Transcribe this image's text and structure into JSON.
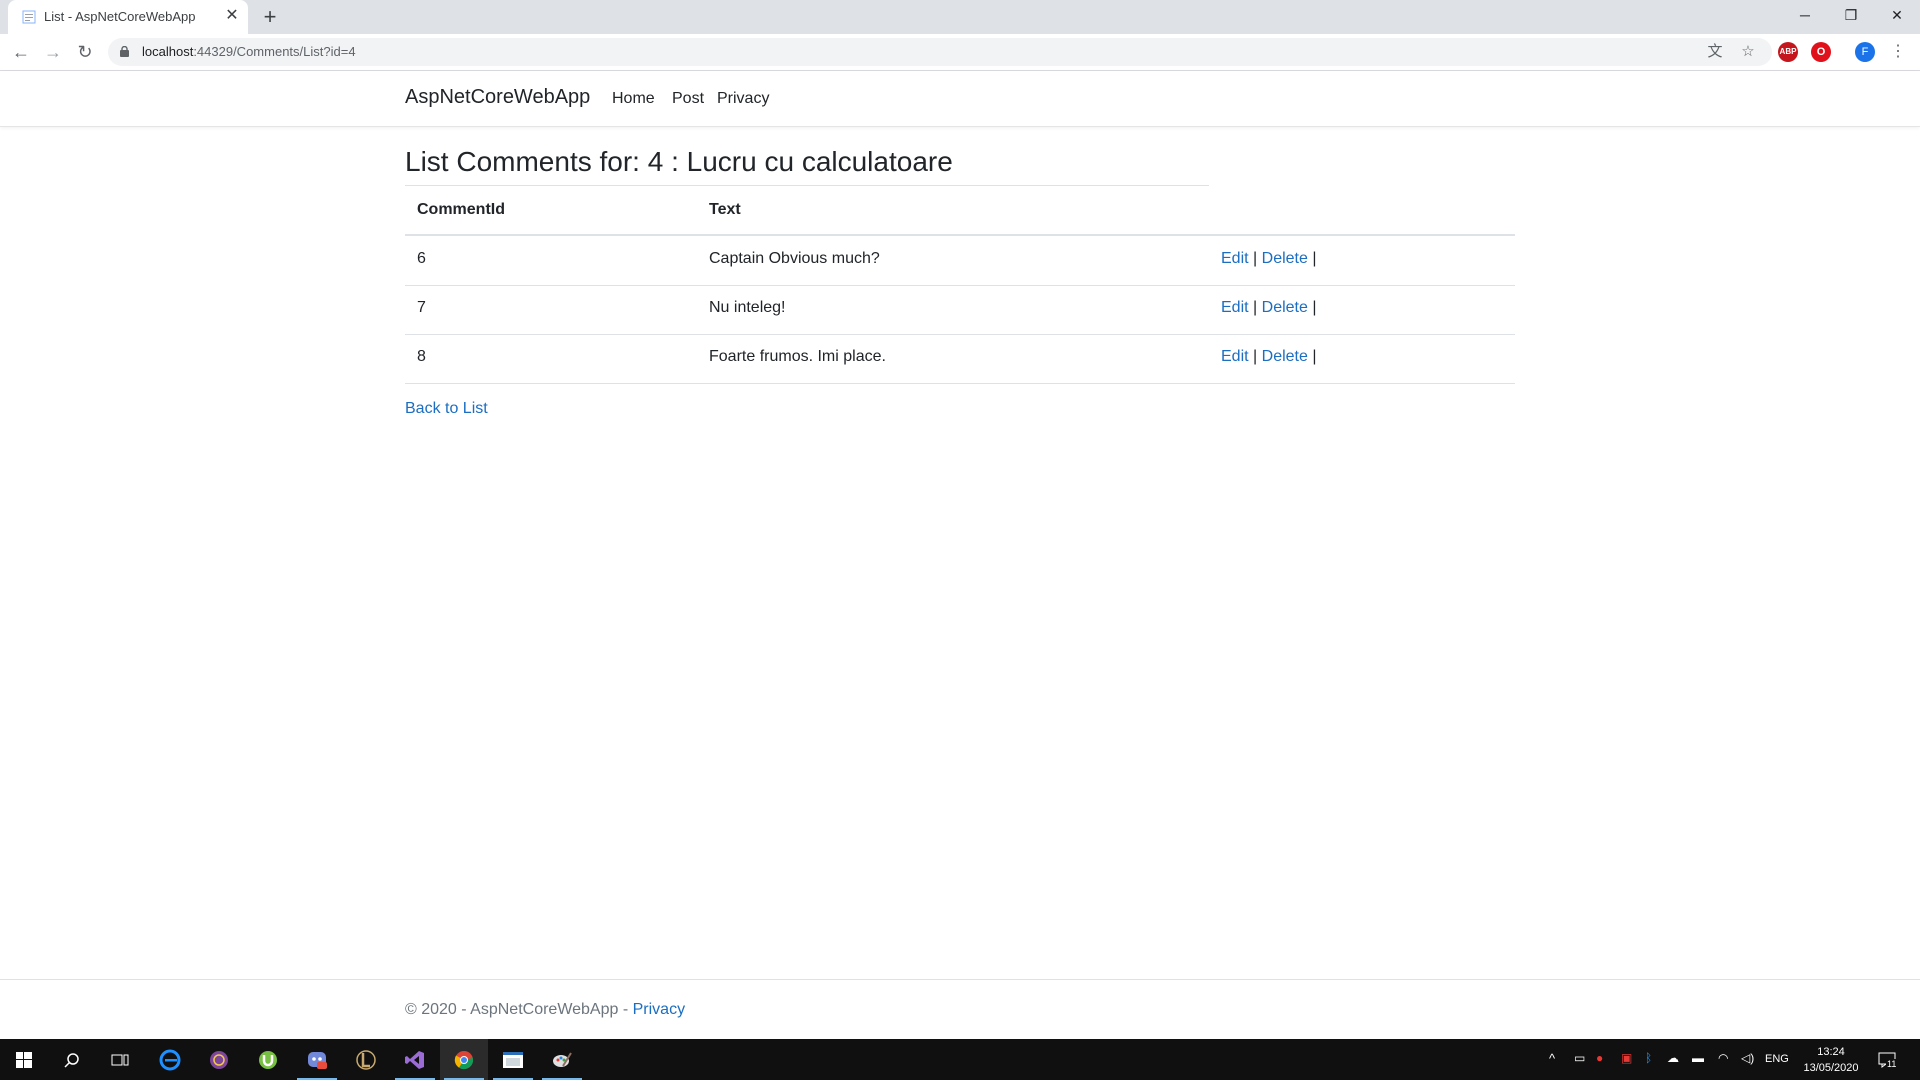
{
  "browser": {
    "tab_title": "List - AspNetCoreWebApp",
    "tab_close": "✕",
    "new_tab": "+",
    "window_minimize": "─",
    "window_restore": "❐",
    "window_close": "✕",
    "back": "←",
    "forward": "→",
    "reload": "↻",
    "url_host": "localhost",
    "url_path": ":44329/Comments/List?id=4",
    "translate_icon": "文",
    "star_icon": "☆",
    "ext_abp": "ABP",
    "ext_opera": "O",
    "profile_initial": "F",
    "menu": "⋮"
  },
  "site": {
    "brand": "AspNetCoreWebApp",
    "nav": [
      "Home",
      "Post",
      "Privacy"
    ]
  },
  "page": {
    "heading": "List Comments for: 4 : Lucru cu calculatoare",
    "columns": [
      "CommentId",
      "Text"
    ],
    "rows": [
      {
        "id": "6",
        "text": "Captain Obvious much?",
        "edit": "Edit",
        "delete": "Delete"
      },
      {
        "id": "7",
        "text": "Nu inteleg!",
        "edit": "Edit",
        "delete": "Delete"
      },
      {
        "id": "8",
        "text": "Foarte frumos. Imi place.",
        "edit": "Edit",
        "delete": "Delete"
      }
    ],
    "separator": "|",
    "back_link": "Back to List"
  },
  "footer": {
    "text": "© 2020 - AspNetCoreWebApp - ",
    "privacy_link": "Privacy"
  },
  "taskbar": {
    "language": "ENG",
    "time": "13:24",
    "date": "13/05/2020",
    "notifications": "11"
  },
  "colors": {
    "link": "#1b6ec2",
    "tabstrip": "#dee1e6",
    "taskbar": "#101010"
  }
}
